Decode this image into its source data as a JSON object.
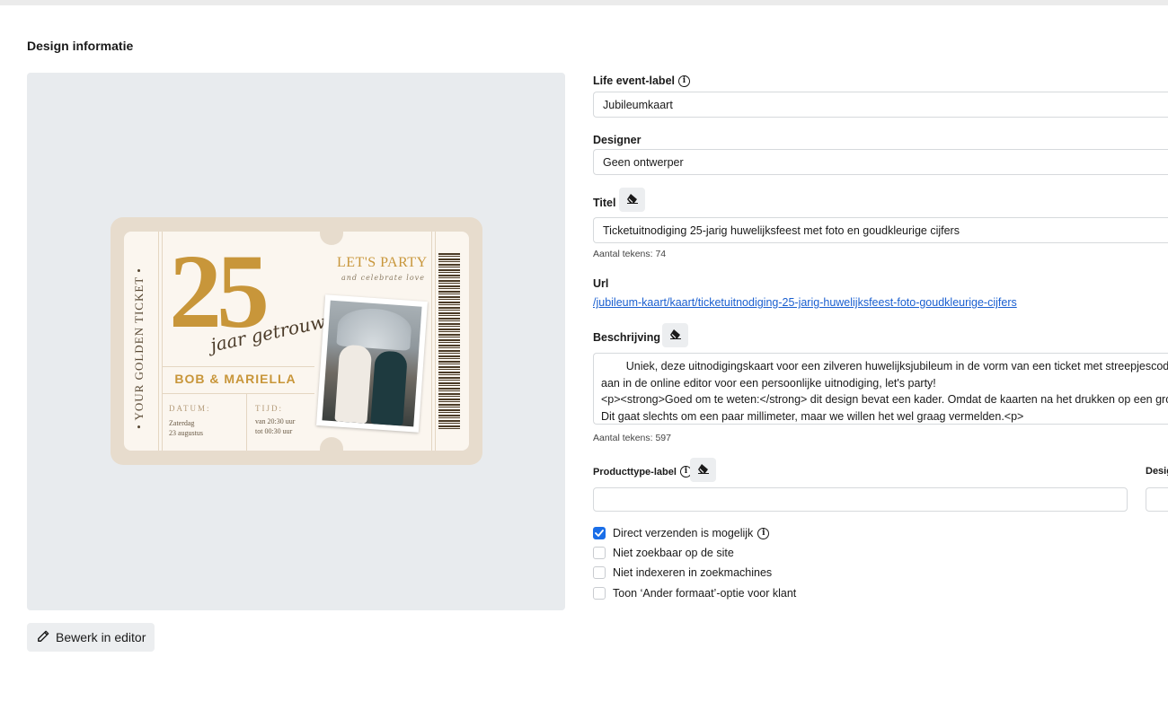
{
  "section": {
    "title": "Design informatie"
  },
  "preview": {
    "ticket": {
      "side_text": "• YOUR GOLDEN TICKET •",
      "big_number": "25",
      "script_text": "jaar getrouwd",
      "headline": "LET'S PARTY",
      "subline": "and celebrate love",
      "names": "BOB & MARIELLA",
      "date_label": "DATUM:",
      "date_value_line1": "Zaterdag",
      "date_value_line2": "23 augustus",
      "time_label": "TIJD:",
      "time_value_line1": "van 20:30 uur",
      "time_value_line2": "tot 00:30 uur"
    }
  },
  "edit_button": {
    "label": "Bewerk in editor",
    "icon": "pencil-icon"
  },
  "form": {
    "life_event": {
      "label": "Life event-label",
      "value": "Jubileumkaart"
    },
    "designer": {
      "label": "Designer",
      "value": "Geen ontwerper"
    },
    "title": {
      "label": "Titel",
      "value": "Ticketuitnodiging 25-jarig huwelijksfeest met foto en goudkleurige cijfers",
      "counter": "Aantal tekens: 74"
    },
    "url": {
      "label": "Url",
      "value": "/jubileum-kaart/kaart/ticketuitnodiging-25-jarig-huwelijksfeest-foto-goudkleurige-cijfers"
    },
    "description": {
      "label": "Beschrijving",
      "value": "        Uniek, deze uitnodigingskaart voor een zilveren huwelijksjubileum in de vorm van een ticket met streepjescode! U\naan in de online editor voor een persoonlijke uitnodiging, let's party!\n<p><strong>Goed om te weten:</strong> dit design bevat een kader. Omdat de kaarten na het drukken op een groot v\nDit gaat slechts om een paar millimeter, maar we willen het wel graag vermelden.<p>",
      "counter": "Aantal tekens: 597"
    },
    "producttype": {
      "label": "Producttype-label",
      "value": ""
    },
    "design_partial": {
      "label": "Desig",
      "value": ""
    },
    "checkboxes": [
      {
        "label": "Direct verzenden is mogelijk",
        "checked": true
      },
      {
        "label": "Niet zoekbaar op de site",
        "checked": false
      },
      {
        "label": "Niet indexeren in zoekmachines",
        "checked": false
      },
      {
        "label": "Toon ‘Ander formaat’-optie voor klant",
        "checked": false
      }
    ]
  },
  "colors": {
    "accent": "#1a6ee8",
    "link": "#1a5fd0",
    "gold": "#c8963a",
    "panel_bg": "#e8ebee"
  }
}
